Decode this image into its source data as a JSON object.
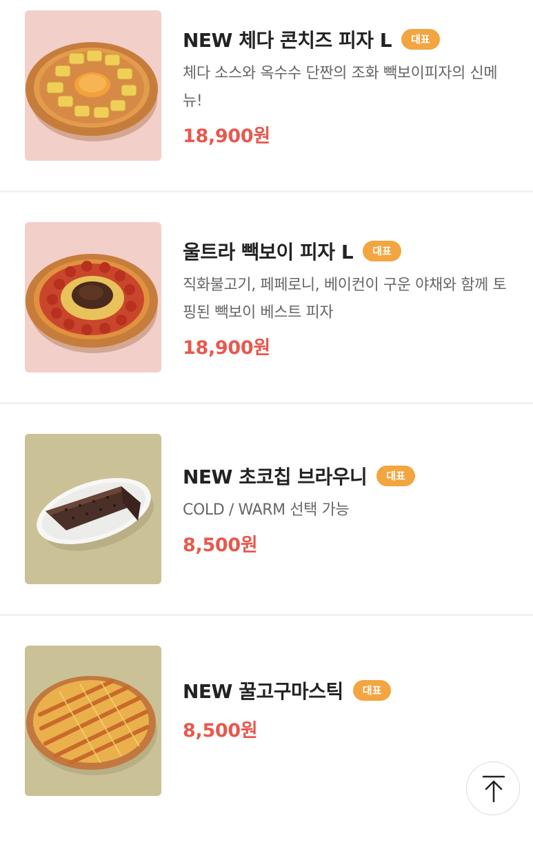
{
  "menu": {
    "items": [
      {
        "title": "NEW 체다 콘치즈 피자 L",
        "badge": "대표",
        "description": "체다 소스와 옥수수 단짠의 조화 빽보이피자의 신메뉴!",
        "price": "18,900원",
        "image_icon": "cheddar-corn-pizza"
      },
      {
        "title": "울트라 빽보이 피자 L",
        "badge": "대표",
        "description": "직화불고기, 페페로니, 베이컨이 구운 야채와 함께 토핑된 빽보이 베스트 피자",
        "price": "18,900원",
        "image_icon": "ultra-paikboy-pizza"
      },
      {
        "title": "NEW 초코칩 브라우니",
        "badge": "대표",
        "description": "COLD / WARM 선택 가능",
        "price": "8,500원",
        "image_icon": "chocochip-brownie"
      },
      {
        "title": "NEW 꿀고구마스틱",
        "badge": "대표",
        "price": "8,500원",
        "image_icon": "honey-sweet-potato-stick"
      }
    ]
  },
  "scroll_top": {
    "icon": "arrow-up-icon"
  },
  "colors": {
    "badge": "#f2a540",
    "price": "#e8584e",
    "pink_bg": "#f3cfc9",
    "olive_bg": "#cbc196"
  }
}
